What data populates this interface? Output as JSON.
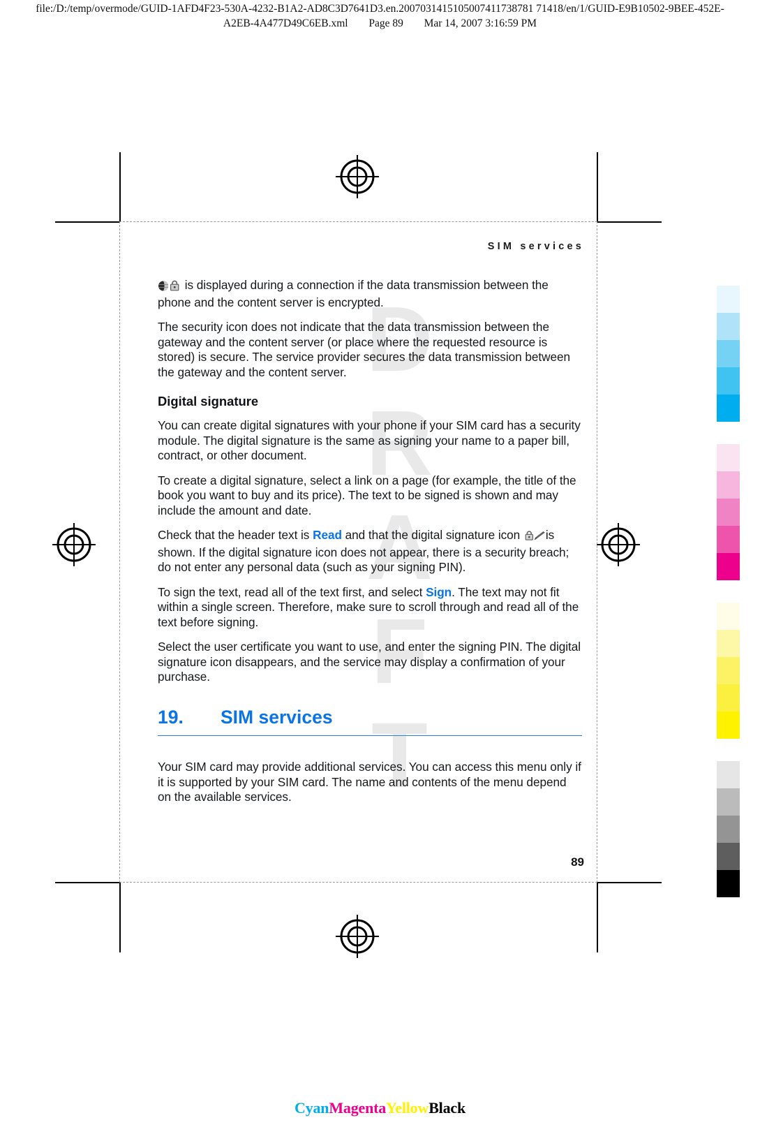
{
  "print_header": {
    "line1": "file:/D:/temp/overmode/GUID-1AFD4F23-530A-4232-B1A2-AD8C3D7641D3.en.20070314151050074117387817141 8/en/1/GUID-E9B10502-9BEE-452E-",
    "line1_exact": "file:/D:/temp/overmode/GUID-1AFD4F23-530A-4232-B1A2-AD8C3D7641D3.en.20070314151050074117387817 1418/en/1/GUID-E9B10502-9BEE-452E-",
    "url": "file:/D:/temp/overmode/GUID-1AFD4F23-530A-4232-B1A2-AD8C3D7641D3.en.2007031415105007411738781 71418/en/1/GUID-E9B10502-9BEE-452E-",
    "filename": "A2EB-4A477D49C6EB.xml",
    "page_label": "Page 89",
    "timestamp": "Mar 14, 2007 3:16:59 PM"
  },
  "running_head": "SIM services",
  "watermark": "DRAFT",
  "body": {
    "paragraphs": [
      {
        "id": "p-security-icon",
        "lead_icon": "globe-lock-icon",
        "text": " is displayed during a connection if the data transmission between the phone and the content server is encrypted."
      },
      {
        "id": "p-security-note",
        "text": "The security icon does not indicate that the data transmission between the gateway and the content server (or place where the requested resource is stored) is secure. The service provider secures the data transmission between the gateway and the content server."
      }
    ],
    "subheading": "Digital signature",
    "paragraphs2": [
      {
        "id": "p-digital-sig-intro",
        "text": "You can create digital signatures with your phone if your SIM card has a security module. The digital signature is the same as signing your name to a paper bill, contract, or other document."
      },
      {
        "id": "p-create-sig",
        "text": "To create a digital signature, select a link on a page (for example, the title of the book you want to buy and its price). The text to be signed is shown and may include the amount and date."
      }
    ],
    "p_check": {
      "part1": "Check that the header text is ",
      "keyword1": "Read",
      "part2": " and that the digital signature icon ",
      "icon": "lock-pen-icon",
      "part3": "is shown. If the digital signature icon does not appear, there is a security breach; do not enter any personal data (such as your signing PIN)."
    },
    "p_sign": {
      "part1": "To sign the text, read all of the text first, and select ",
      "keyword1": "Sign",
      "part2": ". The text may not fit within a single screen. Therefore, make sure to scroll through and read all of the text before signing."
    },
    "p_cert": {
      "text": "Select the user certificate you want to use, and enter the signing PIN. The digital signature icon disappears, and the service may display a confirmation of your purchase."
    }
  },
  "chapter": {
    "number": "19.",
    "title": "SIM services",
    "body": "Your SIM card may provide additional services. You can access this menu only if it is supported by your SIM card. The name and contents of the menu depend on the available services."
  },
  "folio": "89",
  "color_words": [
    {
      "label": "Cyan",
      "color": "#00AEEF"
    },
    {
      "label": "Magenta",
      "color": "#EC008C"
    },
    {
      "label": "Yellow",
      "color": "#FFF200"
    },
    {
      "label": "Black",
      "color": "#000000"
    }
  ],
  "color_bars": [
    {
      "name": "cyan",
      "swatches": [
        "#E8F6FD",
        "#B0E3F8",
        "#76D2F4",
        "#40C3F0",
        "#00AEEF"
      ]
    },
    {
      "name": "magenta",
      "swatches": [
        "#FAE4F1",
        "#F7B6DD",
        "#F083C4",
        "#EE54AC",
        "#EC008C"
      ]
    },
    {
      "name": "yellow",
      "swatches": [
        "#FFFDE8",
        "#FDF7A8",
        "#FCF265",
        "#FBF03F",
        "#FFF200"
      ]
    },
    {
      "name": "black",
      "swatches": [
        "#E6E6E6",
        "#BBBBBB",
        "#949494",
        "#5E5E5E",
        "#000000"
      ]
    }
  ],
  "accents": {
    "link_blue": "#0b73e8",
    "rule_blue": "#2d7fd6",
    "watermark_gray": "#e9e9e9"
  }
}
